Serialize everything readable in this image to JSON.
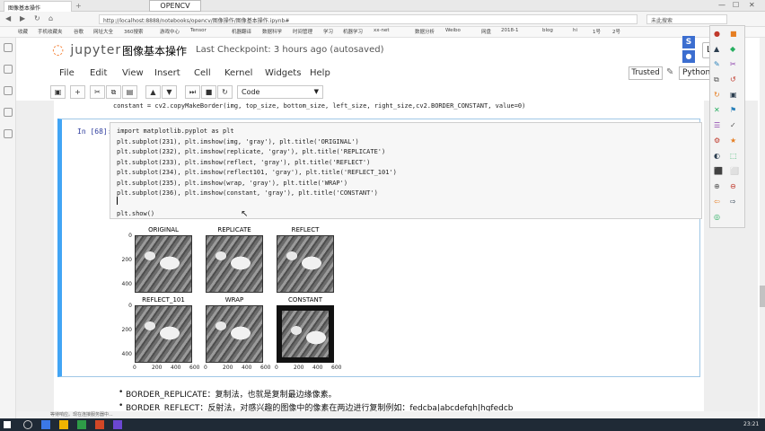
{
  "browser": {
    "tab_title": "图像基本操作",
    "floating_label": "OPENCV",
    "url": "http://localhost:8888/notebooks/opencv/图像操作/图像基本操作.ipynb#",
    "search_text": "未此搜索",
    "bookmarks": [
      "收藏",
      "手机收藏夹",
      "谷歌",
      "网址大全",
      "360搜索",
      "游戏中心",
      "Tensor",
      "机器翻译",
      "数据科学",
      "时间管理",
      "学习",
      "机器学习",
      "xx-net",
      "数据分析",
      "Weibo",
      "网盘",
      "2018-1",
      "blog",
      "hi",
      "1号",
      "2号"
    ]
  },
  "jupyter": {
    "logo": "jupyter",
    "notebook_title": "图像基本操作",
    "checkpoint": "Last Checkpoint: 3 hours ago (autosaved)",
    "logout": "Lo",
    "menu": [
      "File",
      "Edit",
      "View",
      "Insert",
      "Cell",
      "Kernel",
      "Widgets",
      "Help"
    ],
    "trusted": "Trusted",
    "kernel": "Python",
    "cell_type": "Code",
    "toolbar_icons": [
      "save-icon",
      "plus-icon",
      "cut-icon",
      "copy-icon",
      "paste-icon",
      "arrow-up-icon",
      "arrow-down-icon",
      "run-icon",
      "stop-icon",
      "restart-icon"
    ]
  },
  "previous_cell": "constant = cv2.copyMakeBorder(img, top_size, bottom_size, left_size, right_size,cv2.BORDER_CONSTANT, value=0)",
  "cell": {
    "prompt": "In [68]:",
    "lines": [
      "import matplotlib.pyplot as plt",
      "plt.subplot(231), plt.imshow(img, 'gray'), plt.title('ORIGINAL')",
      "plt.subplot(232), plt.imshow(replicate, 'gray'), plt.title('REPLICATE')",
      "plt.subplot(233), plt.imshow(reflect, 'gray'), plt.title('REFLECT')",
      "plt.subplot(234), plt.imshow(reflect101, 'gray'), plt.title('REFLECT_101')",
      "plt.subplot(235), plt.imshow(wrap, 'gray'), plt.title('WRAP')",
      "plt.subplot(236), plt.imshow(constant, 'gray'), plt.title('CONSTANT')",
      "",
      "plt.show()"
    ]
  },
  "plots": {
    "titles": [
      "ORIGINAL",
      "REPLICATE",
      "REFLECT",
      "REFLECT_101",
      "WRAP",
      "CONSTANT"
    ],
    "yticks": [
      "0",
      "200",
      "400"
    ],
    "xticks": [
      "0",
      "200",
      "400",
      "600"
    ]
  },
  "markdown": {
    "line1": "BORDER_REPLICATE：复制法，也就是复制最边缘像素。",
    "line2": "BORDER_REFLECT：反射法，对感兴趣的图像中的像素在两边进行复制例如：fedcba|abcdefgh|hgfedcb"
  },
  "statusbar": "等待响应。现在连接服务器中...",
  "taskbar": {
    "clock": "23:21"
  }
}
